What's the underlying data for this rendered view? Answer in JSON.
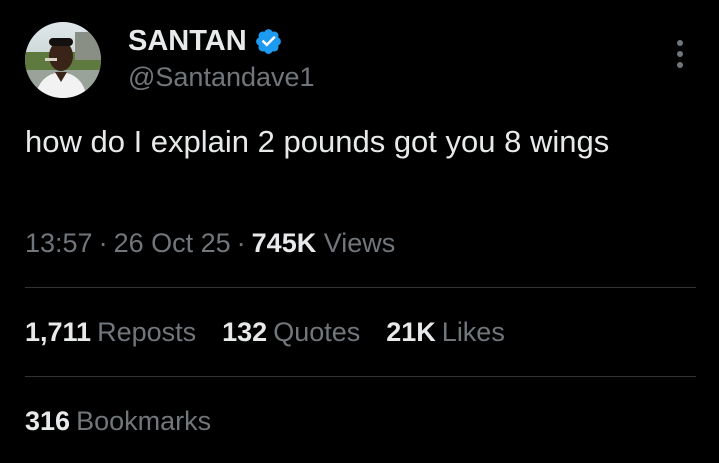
{
  "author": {
    "display_name": "SANTAN",
    "handle": "@Santandave1",
    "avatar_icon": "profile-photo",
    "verified_icon": "verified-badge-icon",
    "verified_color": "#1d9bf0"
  },
  "more_icon": "more-options-icon",
  "tweet": {
    "text": "how do I explain 2 pounds got you 8 wings",
    "time": "13:57",
    "date": "26 Oct 25",
    "views_count": "745K",
    "views_label": "Views"
  },
  "stats": {
    "reposts_count": "1,711",
    "reposts_label": "Reposts",
    "quotes_count": "132",
    "quotes_label": "Quotes",
    "likes_count": "21K",
    "likes_label": "Likes",
    "bookmarks_count": "316",
    "bookmarks_label": "Bookmarks"
  },
  "colors": {
    "background": "#000000",
    "primary_text": "#e7e9ea",
    "secondary_text": "#71767b",
    "divider": "#2f3336"
  }
}
